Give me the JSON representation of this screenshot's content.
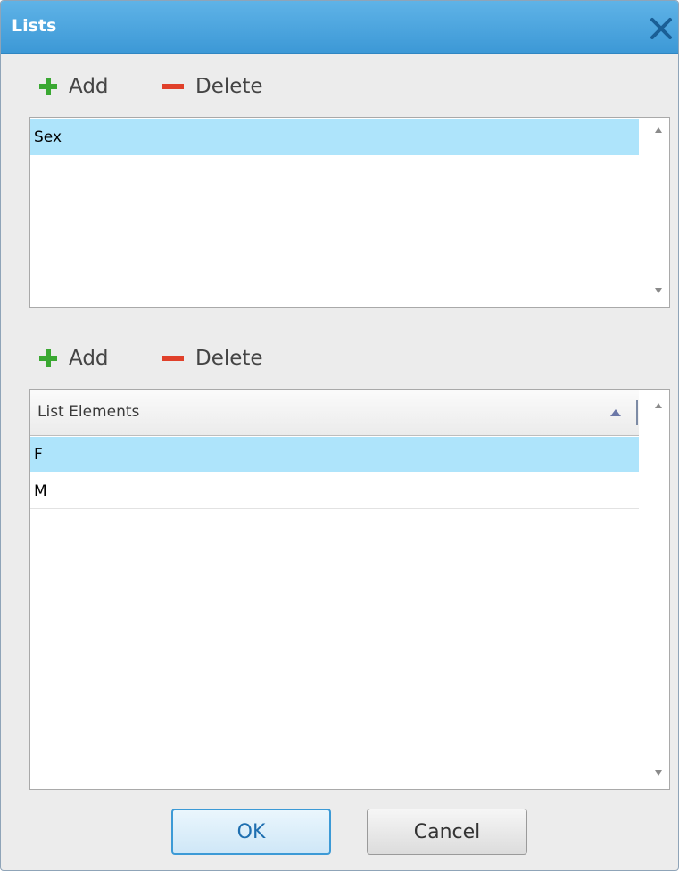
{
  "window": {
    "title": "Lists",
    "close_icon": "close-icon"
  },
  "lists_toolbar": {
    "add_label": "Add",
    "delete_label": "Delete",
    "add_icon": "plus-icon",
    "delete_icon": "minus-icon"
  },
  "lists": {
    "items": [
      {
        "label": "Sex",
        "selected": true
      }
    ]
  },
  "elements_toolbar": {
    "add_label": "Add",
    "delete_label": "Delete"
  },
  "elements": {
    "column_header": "List Elements",
    "sort_direction": "ascending",
    "rows": [
      {
        "label": "F",
        "selected": true
      },
      {
        "label": "M",
        "selected": false
      }
    ]
  },
  "buttons": {
    "ok_label": "OK",
    "cancel_label": "Cancel"
  },
  "colors": {
    "title_bar": "#3c98d6",
    "selection": "#aee4fb",
    "add_icon": "#3aa832",
    "delete_icon": "#e0402a"
  }
}
